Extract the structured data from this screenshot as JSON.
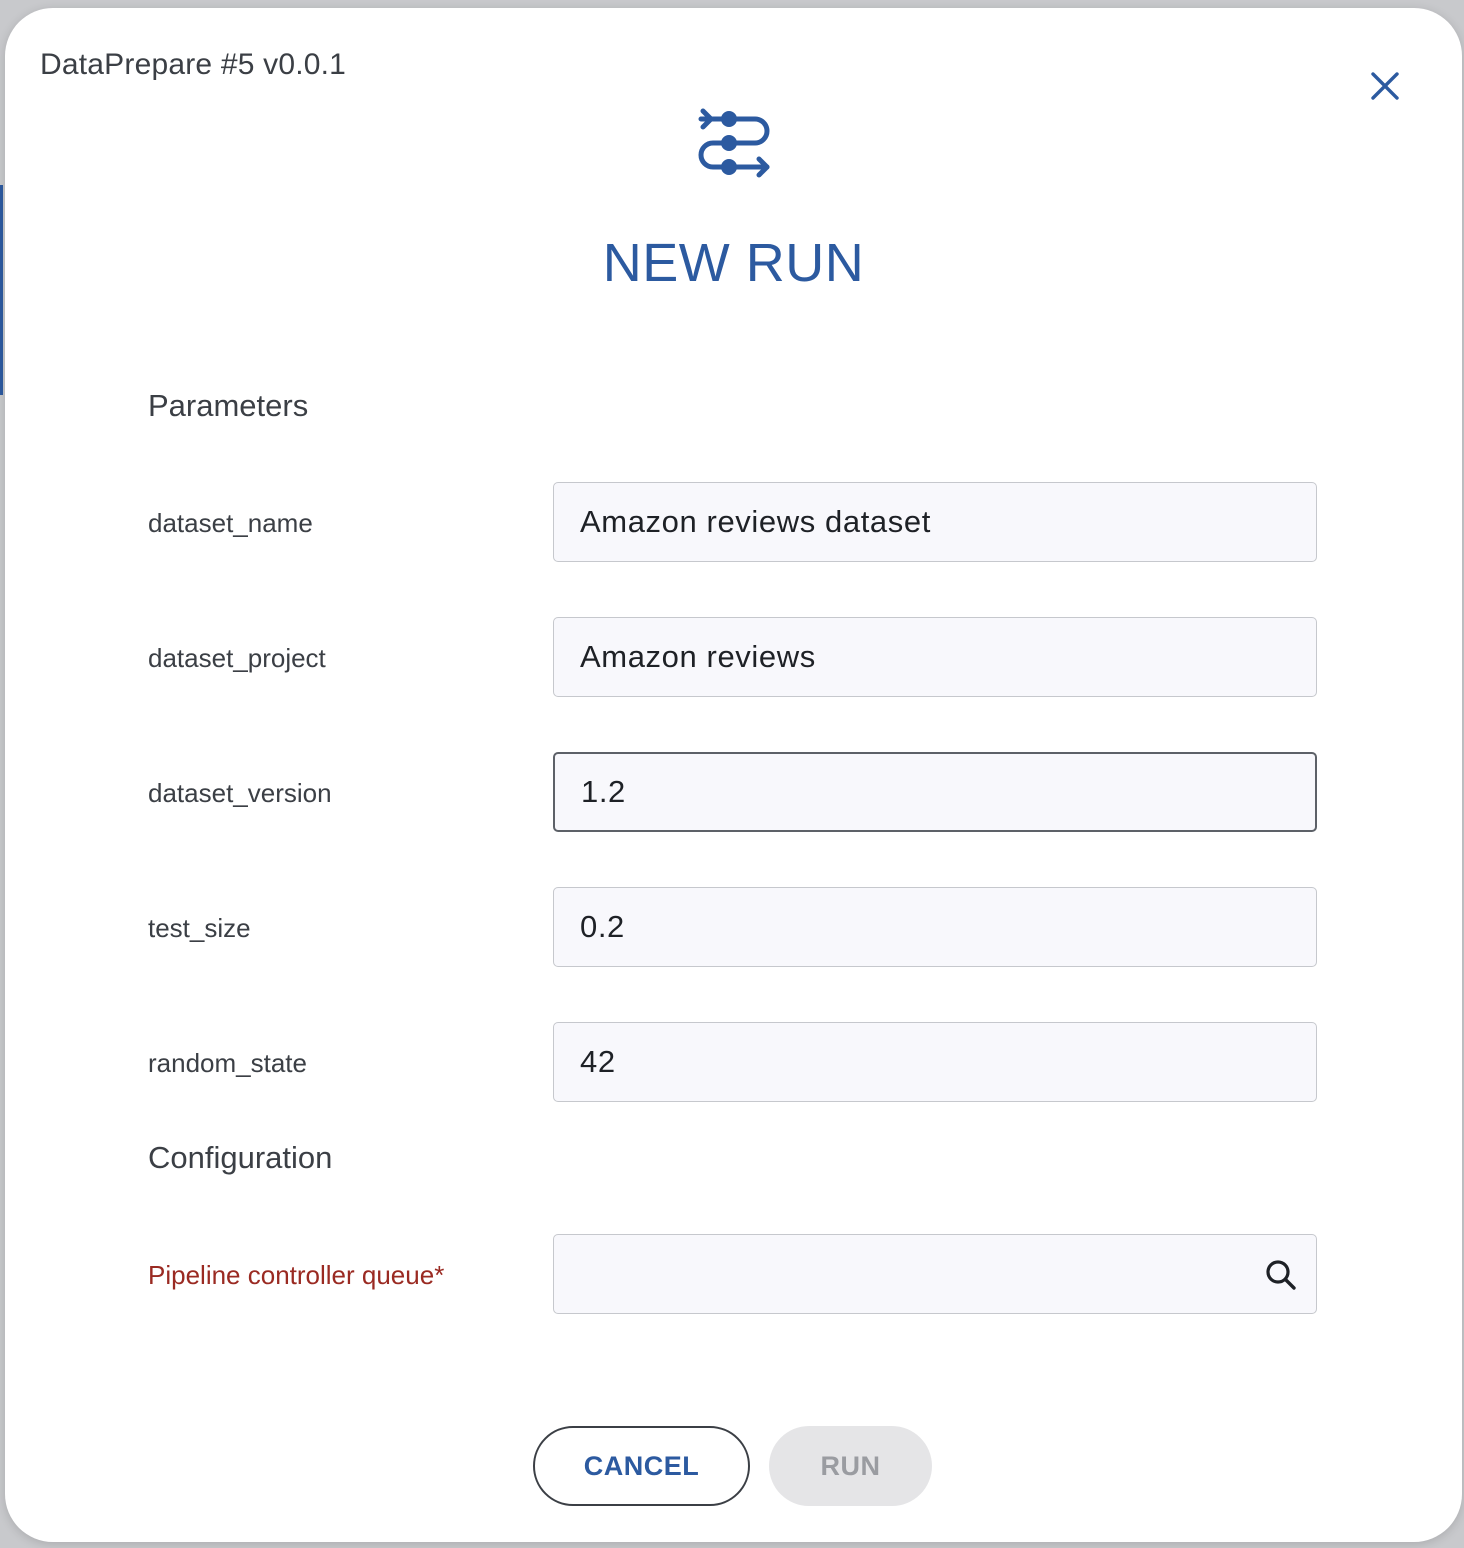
{
  "dialog": {
    "title": "DataPrepare #5 v0.0.1",
    "heading": "NEW RUN",
    "icons": {
      "close": "close-icon",
      "header": "pipeline-icon"
    }
  },
  "parameters": {
    "section_title": "Parameters",
    "fields": [
      {
        "label": "dataset_name",
        "value": "Amazon reviews dataset"
      },
      {
        "label": "dataset_project",
        "value": "Amazon reviews"
      },
      {
        "label": "dataset_version",
        "value": "1.2",
        "focused": true
      },
      {
        "label": "test_size",
        "value": "0.2"
      },
      {
        "label": "random_state",
        "value": "42"
      }
    ]
  },
  "configuration": {
    "section_title": "Configuration",
    "queue_label": "Pipeline controller queue*",
    "queue_value": "",
    "search_icon": "search-icon"
  },
  "actions": {
    "cancel_label": "CANCEL",
    "run_label": "RUN",
    "run_enabled": false
  },
  "colors": {
    "accent": "#2c5aa0",
    "required_label": "#9a2a22",
    "input_bg": "#f8f8fc",
    "disabled_btn_bg": "#e5e5e7"
  }
}
